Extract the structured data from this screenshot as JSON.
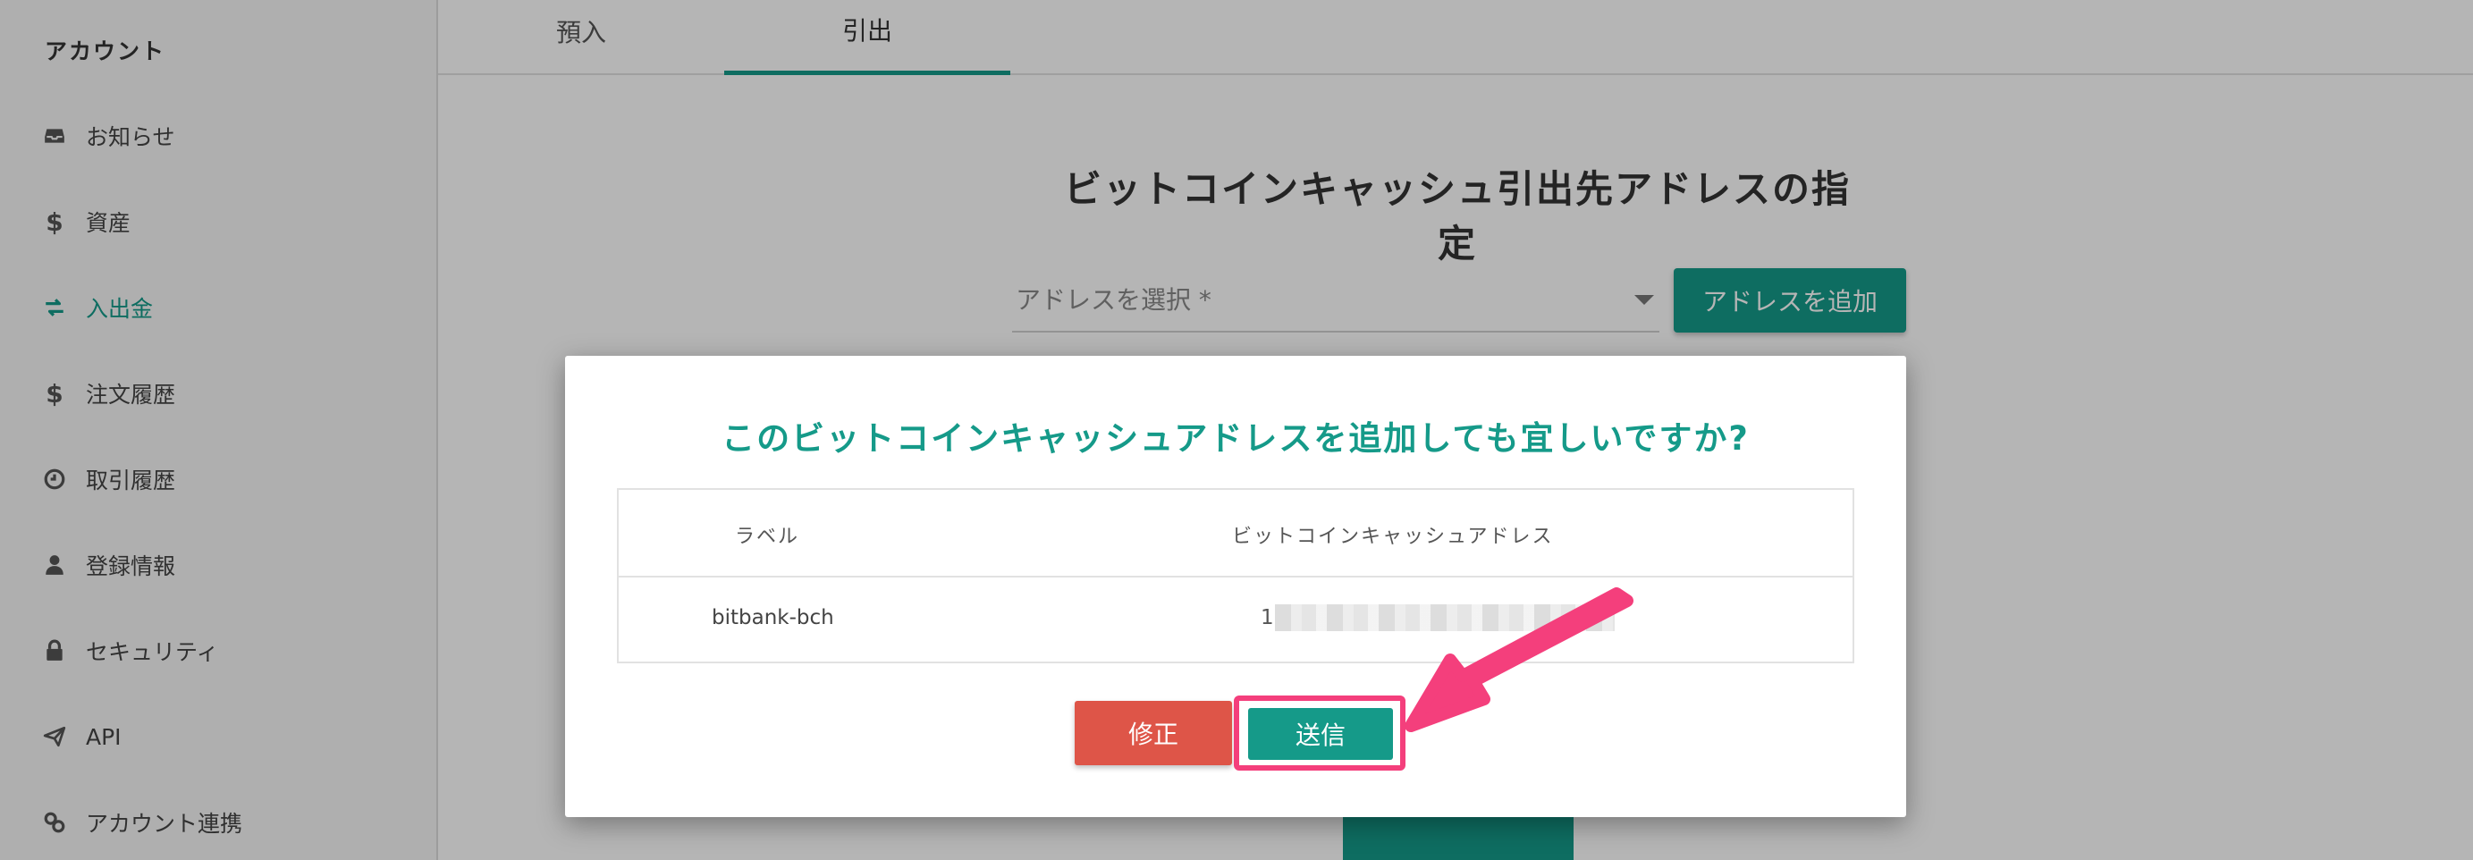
{
  "sidebar": {
    "heading": "アカウント",
    "items": [
      {
        "label": "お知らせ",
        "icon": "inbox-icon"
      },
      {
        "label": "資産",
        "icon": "dollar-icon"
      },
      {
        "label": "入出金",
        "icon": "exchange-icon"
      },
      {
        "label": "注文履歴",
        "icon": "dollar-icon"
      },
      {
        "label": "取引履歴",
        "icon": "clock-icon"
      },
      {
        "label": "登録情報",
        "icon": "user-icon"
      },
      {
        "label": "セキュリティ",
        "icon": "lock-icon"
      },
      {
        "label": "API",
        "icon": "paper-plane-icon"
      },
      {
        "label": "アカウント連携",
        "icon": "link-icon"
      }
    ],
    "active_index": 2
  },
  "tabs": [
    {
      "label": "預入"
    },
    {
      "label": "引出"
    }
  ],
  "main": {
    "title": "ビットコインキャッシュ引出先アドレスの指定",
    "select_placeholder": "アドレスを選択 *",
    "add_address_label": "アドレスを追加"
  },
  "modal": {
    "title": "このビットコインキャッシュアドレスを追加しても宜しいですか?",
    "table": {
      "headers": [
        "ラベル",
        "ビットコインキャッシュアドレス"
      ],
      "row": {
        "label": "bitbank-bch",
        "address_prefix": "1"
      }
    },
    "fix_label": "修正",
    "send_label": "送信"
  },
  "colors": {
    "accent": "#159a89",
    "danger": "#de5548",
    "highlight": "#f43f7c"
  }
}
